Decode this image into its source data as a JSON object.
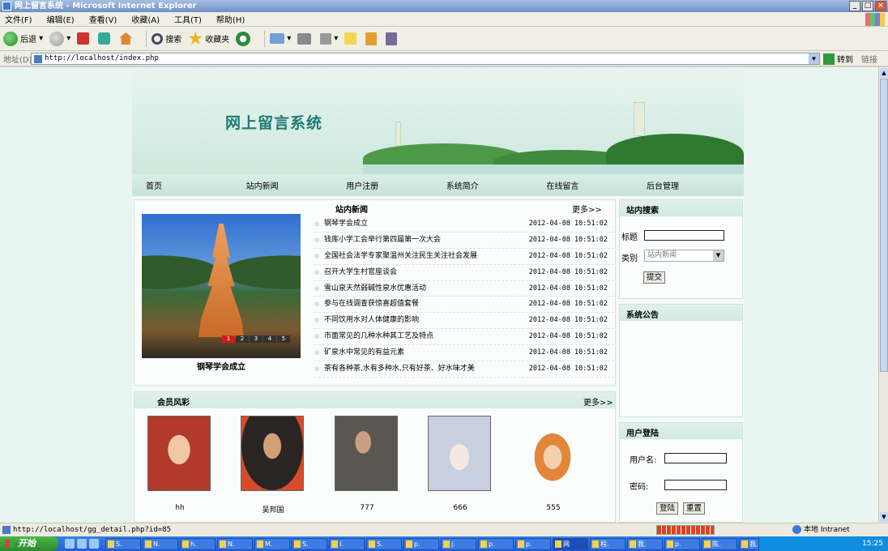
{
  "window": {
    "title": "网上留言系统 - Microsoft Internet Explorer"
  },
  "menu": [
    "文件(F)",
    "编辑(E)",
    "查看(V)",
    "收藏(A)",
    "工具(T)",
    "帮助(H)"
  ],
  "toolbar": {
    "back_label": "后退",
    "search_label": "搜索",
    "favorites_label": "收藏夹"
  },
  "address": {
    "label": "地址(D)",
    "url": "http://localhost/index.php",
    "go_label": "转到",
    "links_label": "链接"
  },
  "site": {
    "title": "网上留言系统",
    "nav": [
      "首页",
      "站内新闻",
      "用户注册",
      "系统简介",
      "在线留言",
      "后台管理"
    ],
    "news": {
      "heading": "站内新闻",
      "more": "更多>>",
      "photo_caption": "钢琴学会成立",
      "slide_numbers": [
        "1",
        "2",
        "3",
        "4",
        "5"
      ],
      "items": [
        {
          "title": "钢琴学会成立",
          "date": "2012-04-08 10:51:02"
        },
        {
          "title": "钱库小学工会举行第四届第一次大会",
          "date": "2012-04-08 10:51:02"
        },
        {
          "title": "全国社会法学专家聚温州关注民生关注社会发展",
          "date": "2012-04-08 10:51:02"
        },
        {
          "title": "召开大学生村官座谈会",
          "date": "2012-04-08 10:51:02"
        },
        {
          "title": "雪山泉天然弱碱性泉水优惠活动",
          "date": "2012-04-08 10:51:02"
        },
        {
          "title": "参与在线调查获惊喜超值套餐",
          "date": "2012-04-08 10:51:02"
        },
        {
          "title": "不同饮用水对人体健康的影响",
          "date": "2012-04-08 10:51:02"
        },
        {
          "title": "市面常见的几种水种其工艺及特点",
          "date": "2012-04-08 10:51:02"
        },
        {
          "title": "矿泉水中常见的有益元素",
          "date": "2012-04-08 10:51:02"
        },
        {
          "title": "茶有各种茶,水有多种水,只有好茶、好水味才美",
          "date": "2012-04-08 10:51:02"
        }
      ]
    },
    "members": {
      "heading": "会员风彩",
      "more": "更多>>",
      "list": [
        {
          "name": "hh",
          "color": "#b23a2a"
        },
        {
          "name": "吴邦国",
          "color": "#3a2a28"
        },
        {
          "name": "777",
          "color": "#5a5650"
        },
        {
          "name": "666",
          "color": "#c8d0e0"
        },
        {
          "name": "555",
          "color": "#e2873a"
        }
      ]
    },
    "site_search": {
      "heading": "站内搜索",
      "title_label": "标题",
      "title_value": "",
      "category_label": "类别",
      "category_value": "站内新闻",
      "submit_label": "提交"
    },
    "announcement": {
      "heading": "系统公告"
    },
    "login": {
      "heading": "用户登陆",
      "username_label": "用户名:",
      "username_value": "",
      "password_label": "密码:",
      "password_value": "",
      "login_label": "登陆",
      "reset_label": "重置"
    }
  },
  "status": {
    "url": "http://localhost/gg_detail.php?id=85",
    "zone": "本地 Intranet"
  },
  "taskbar": {
    "start_label": "开始",
    "tasks": [
      "S.",
      "N.",
      "h.",
      "N.",
      "M.",
      "S.",
      "I.",
      "S.",
      "p.",
      "j.",
      "p.",
      "p.",
      "网",
      "程.",
      "我.",
      "p.",
      "陈.",
      "我."
    ],
    "clock": "15:25"
  }
}
